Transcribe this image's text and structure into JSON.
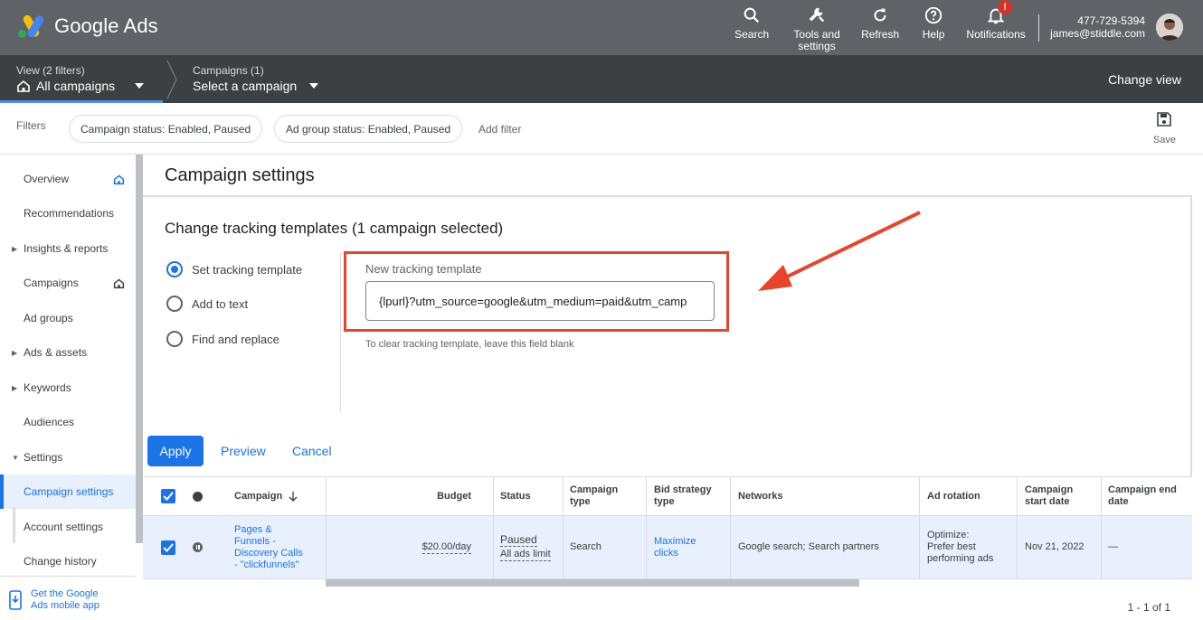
{
  "header": {
    "app_name": "Google Ads",
    "nav": [
      {
        "label": "Search",
        "icon": "search-icon"
      },
      {
        "label": "Tools and settings",
        "icon": "wrench-icon"
      },
      {
        "label": "Refresh",
        "icon": "refresh-icon"
      },
      {
        "label": "Help",
        "icon": "help-icon"
      },
      {
        "label": "Notifications",
        "icon": "bell-icon",
        "badge": "!"
      }
    ],
    "account_id": "477-729-5394",
    "account_email": "james@stiddle.com"
  },
  "subnav": {
    "view_label": "View (2 filters)",
    "view_value": "All campaigns",
    "campaigns_label": "Campaigns (1)",
    "campaigns_value": "Select a campaign",
    "change_view": "Change view"
  },
  "filters": {
    "label": "Filters",
    "chips": [
      "Campaign status: Enabled, Paused",
      "Ad group status: Enabled, Paused"
    ],
    "add_filter": "Add filter",
    "save": "Save"
  },
  "sidebar": {
    "items": [
      {
        "label": "Overview"
      },
      {
        "label": "Recommendations"
      },
      {
        "label": "Insights & reports"
      },
      {
        "label": "Campaigns"
      },
      {
        "label": "Ad groups"
      },
      {
        "label": "Ads & assets"
      },
      {
        "label": "Keywords"
      },
      {
        "label": "Audiences"
      },
      {
        "label": "Settings"
      },
      {
        "label": "Campaign settings"
      },
      {
        "label": "Account settings"
      },
      {
        "label": "Change history"
      }
    ],
    "mobile_app": "Get the Google Ads mobile app"
  },
  "main": {
    "page_title": "Campaign settings",
    "section_title": "Change tracking templates (1 campaign selected)",
    "options": [
      "Set tracking template",
      "Add to text",
      "Find and replace"
    ],
    "field_label": "New tracking template",
    "field_value": "{lpurl}?utm_source=google&utm_medium=paid&utm_camp",
    "hint": "To clear tracking template, leave this field blank",
    "apply": "Apply",
    "preview": "Preview",
    "cancel": "Cancel"
  },
  "table": {
    "headers": {
      "campaign": "Campaign",
      "budget": "Budget",
      "status": "Status",
      "campaign_type": "Campaign type",
      "bid_strategy": "Bid strategy type",
      "networks": "Networks",
      "ad_rotation": "Ad rotation",
      "start_date": "Campaign start date",
      "end_date": "Campaign end date"
    },
    "rows": [
      {
        "campaign": "Pages & Funnels - Discovery Calls - \"clickfunnels\"",
        "budget": "$20.00/day",
        "status": "Paused",
        "status_detail": "All ads limit",
        "campaign_type": "Search",
        "bid_strategy": "Maximize clicks",
        "networks": "Google search; Search partners",
        "ad_rotation": "Optimize: Prefer best performing ads",
        "start_date": "Nov 21, 2022",
        "end_date": "—"
      }
    ],
    "pagination": "1 - 1 of 1"
  },
  "colors": {
    "accent": "#1a73e8",
    "highlight": "#e8432d",
    "header_bg": "#5f6368",
    "subnav_bg": "#3c4043"
  }
}
